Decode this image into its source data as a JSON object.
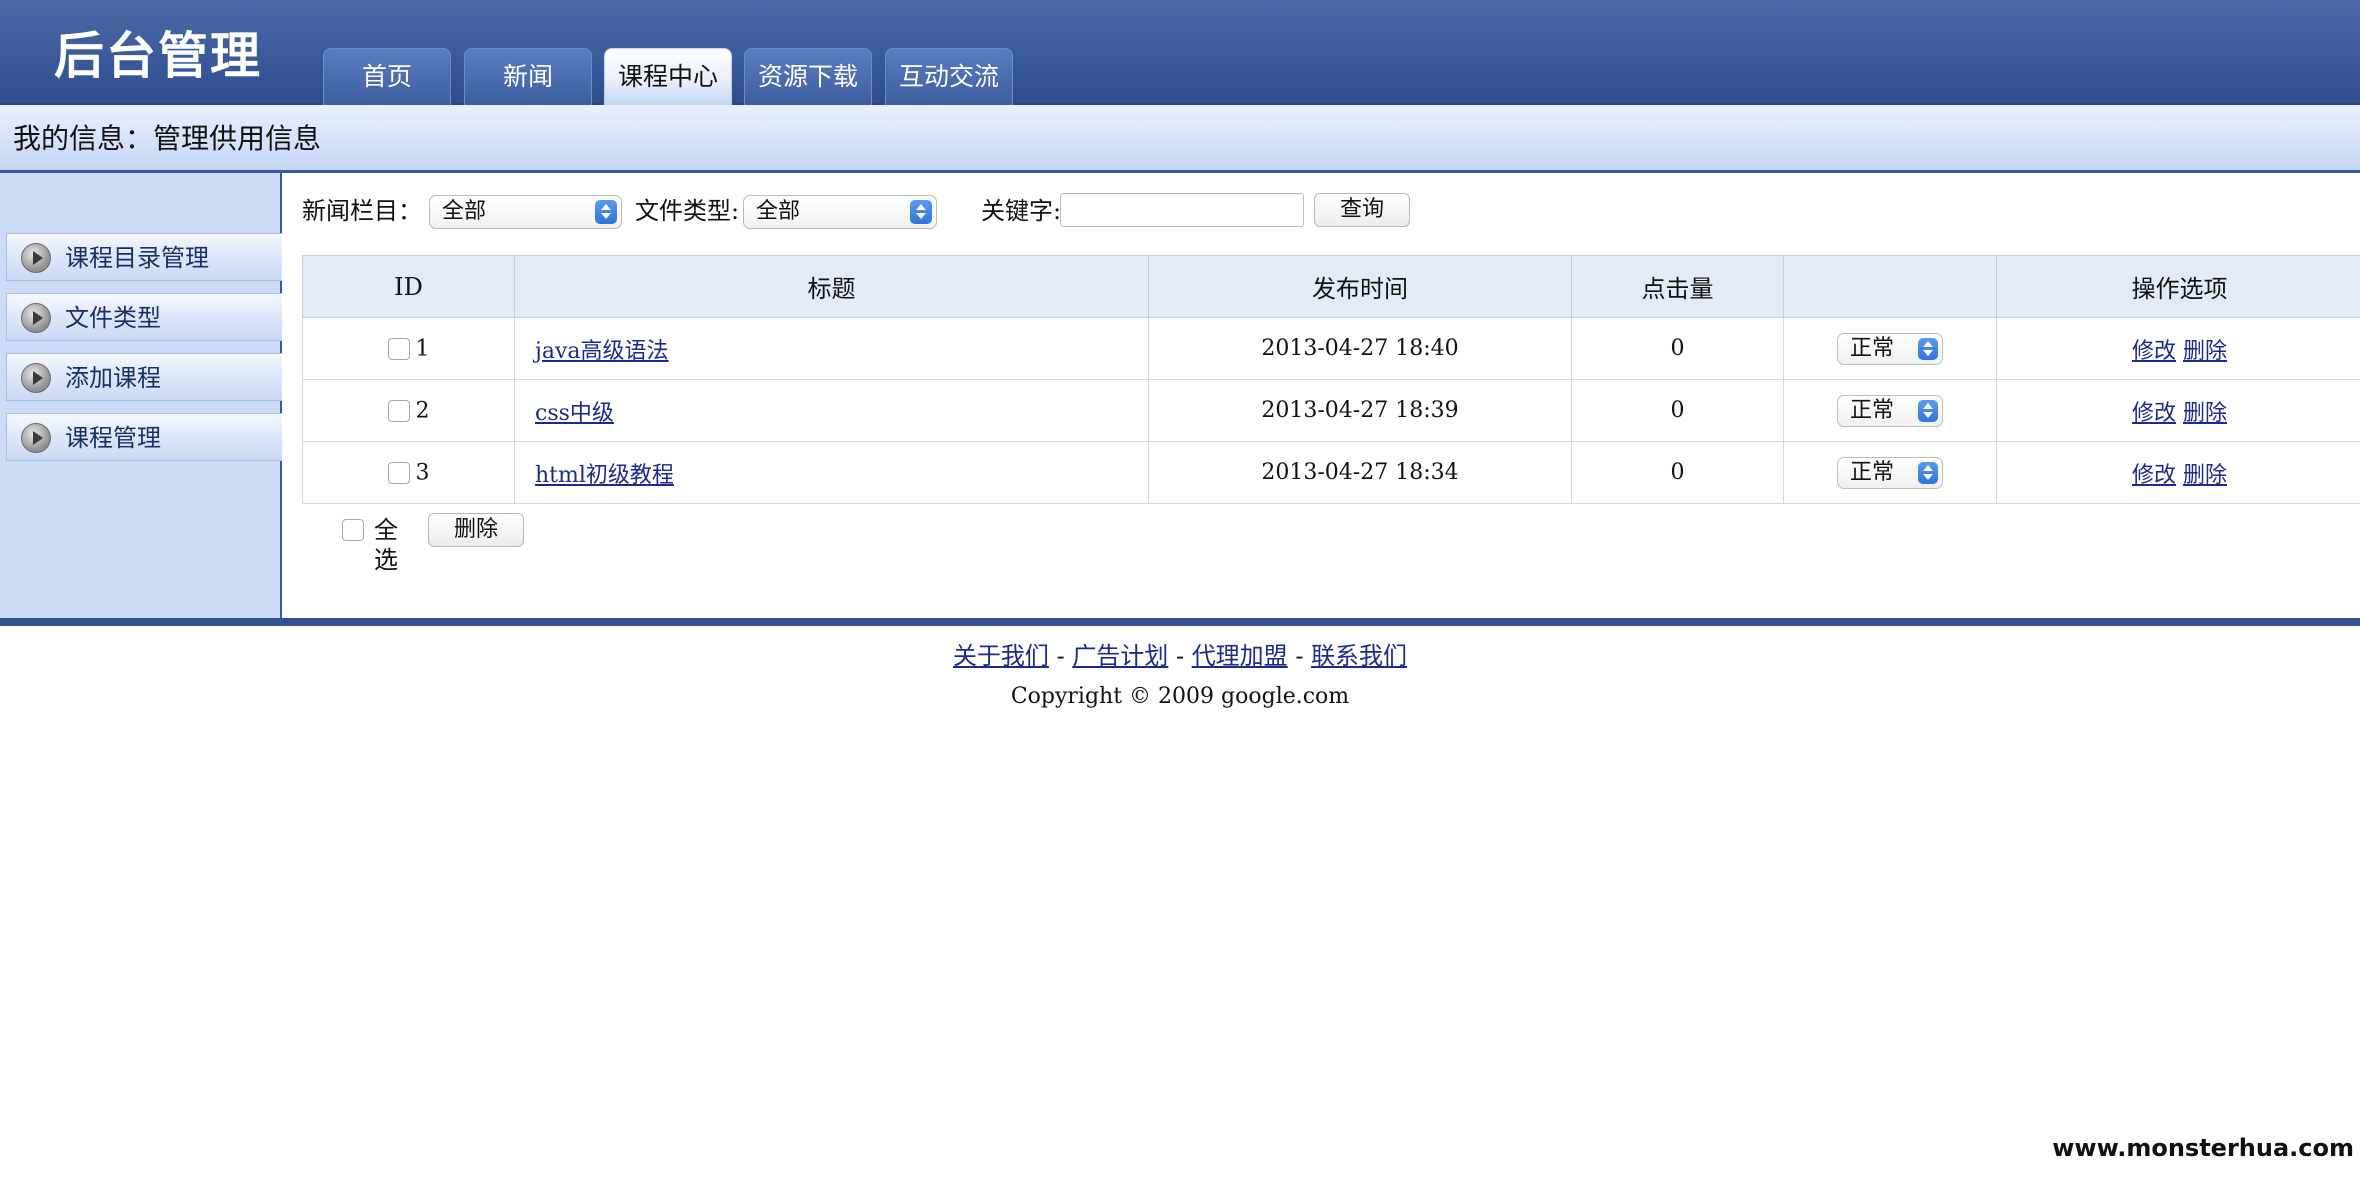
{
  "header": {
    "logo": "后台管理",
    "tabs": [
      {
        "label": "首页",
        "active": false
      },
      {
        "label": "新闻",
        "active": false
      },
      {
        "label": "课程中心",
        "active": true
      },
      {
        "label": "资源下载",
        "active": false
      },
      {
        "label": "互动交流",
        "active": false
      }
    ]
  },
  "infobar": {
    "label": "我的信息：管理供用信息"
  },
  "sidebar": {
    "items": [
      {
        "label": "课程目录管理",
        "icon": "arrow-circle-icon"
      },
      {
        "label": "文件类型",
        "icon": "arrow-circle-icon"
      },
      {
        "label": "添加课程",
        "icon": "arrow-circle-icon"
      },
      {
        "label": "课程管理",
        "icon": "arrow-circle-icon"
      }
    ]
  },
  "filters": {
    "category_label": "新闻栏目：",
    "category_value": "全部",
    "filetype_label": "文件类型:",
    "filetype_value": "全部",
    "keyword_label": "关键字:",
    "keyword_value": "",
    "search_button": "查询"
  },
  "table": {
    "headers": {
      "id": "ID",
      "title": "标题",
      "published": "发布时间",
      "clicks": "点击量",
      "status": "",
      "actions": "操作选项"
    },
    "rows": [
      {
        "id": "1",
        "title": "java高级语法",
        "published": "2013-04-27 18:40",
        "clicks": "0",
        "status": "正常",
        "edit": "修改",
        "delete": "删除"
      },
      {
        "id": "2",
        "title": "css中级",
        "published": "2013-04-27 18:39",
        "clicks": "0",
        "status": "正常",
        "edit": "修改",
        "delete": "删除"
      },
      {
        "id": "3",
        "title": "html初级教程",
        "published": "2013-04-27 18:34",
        "clicks": "0",
        "status": "正常",
        "edit": "修改",
        "delete": "删除"
      }
    ]
  },
  "bulk": {
    "select_all_label": "全选",
    "delete_button": "删除"
  },
  "footer": {
    "links": [
      "关于我们",
      "广告计划",
      "代理加盟",
      "联系我们"
    ],
    "separator": " - ",
    "copyright": "Copyright © 2009 google.com"
  },
  "watermark": "www.monsterhua.com",
  "colors": {
    "header": "#3a5a9a",
    "sidebar": "#ccdcf7",
    "table_header": "#e3ebf8",
    "link": "#1b2a8e",
    "select_accent": "#2f74d8"
  }
}
